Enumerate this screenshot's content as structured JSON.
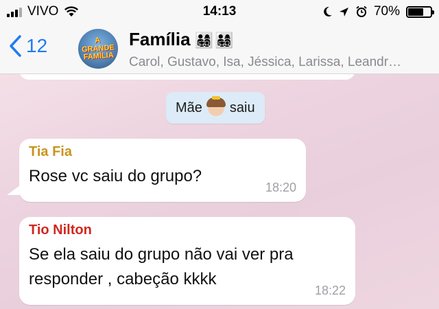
{
  "status_bar": {
    "carrier": "VIVO",
    "time": "14:13",
    "battery_percent": "70%",
    "battery_level": 0.7,
    "icons": [
      "signal-icon",
      "wifi-icon",
      "moon-icon",
      "location-icon",
      "alarm-icon",
      "battery-icon"
    ]
  },
  "header": {
    "back_count": "12",
    "avatar_text": "A GRANDE FAMÍLIA",
    "group_name": "Família",
    "group_emoji": "👨‍👩‍👧‍👦👨‍👩‍👧‍👦",
    "members": "Carol, Gustavo, Isa, Jéssica, Larissa, Leandr…"
  },
  "chat": {
    "system_message": {
      "name": "Mãe",
      "action": "saiu"
    },
    "messages": [
      {
        "sender": "Tia Fia",
        "sender_color": "#c8941c",
        "text": "Rose vc saiu do grupo?",
        "time": "18:20"
      },
      {
        "sender": "Tio Nilton",
        "sender_color": "#d0281f",
        "text_lines": [
          "Se ela saiu do grupo não vai ver pra",
          "responder , cabeção kkkk"
        ],
        "time": "18:22"
      }
    ]
  },
  "colors": {
    "accent": "#1f7cf1",
    "system_bubble": "#dcebf7",
    "header_bg": "#f7f7f8"
  }
}
